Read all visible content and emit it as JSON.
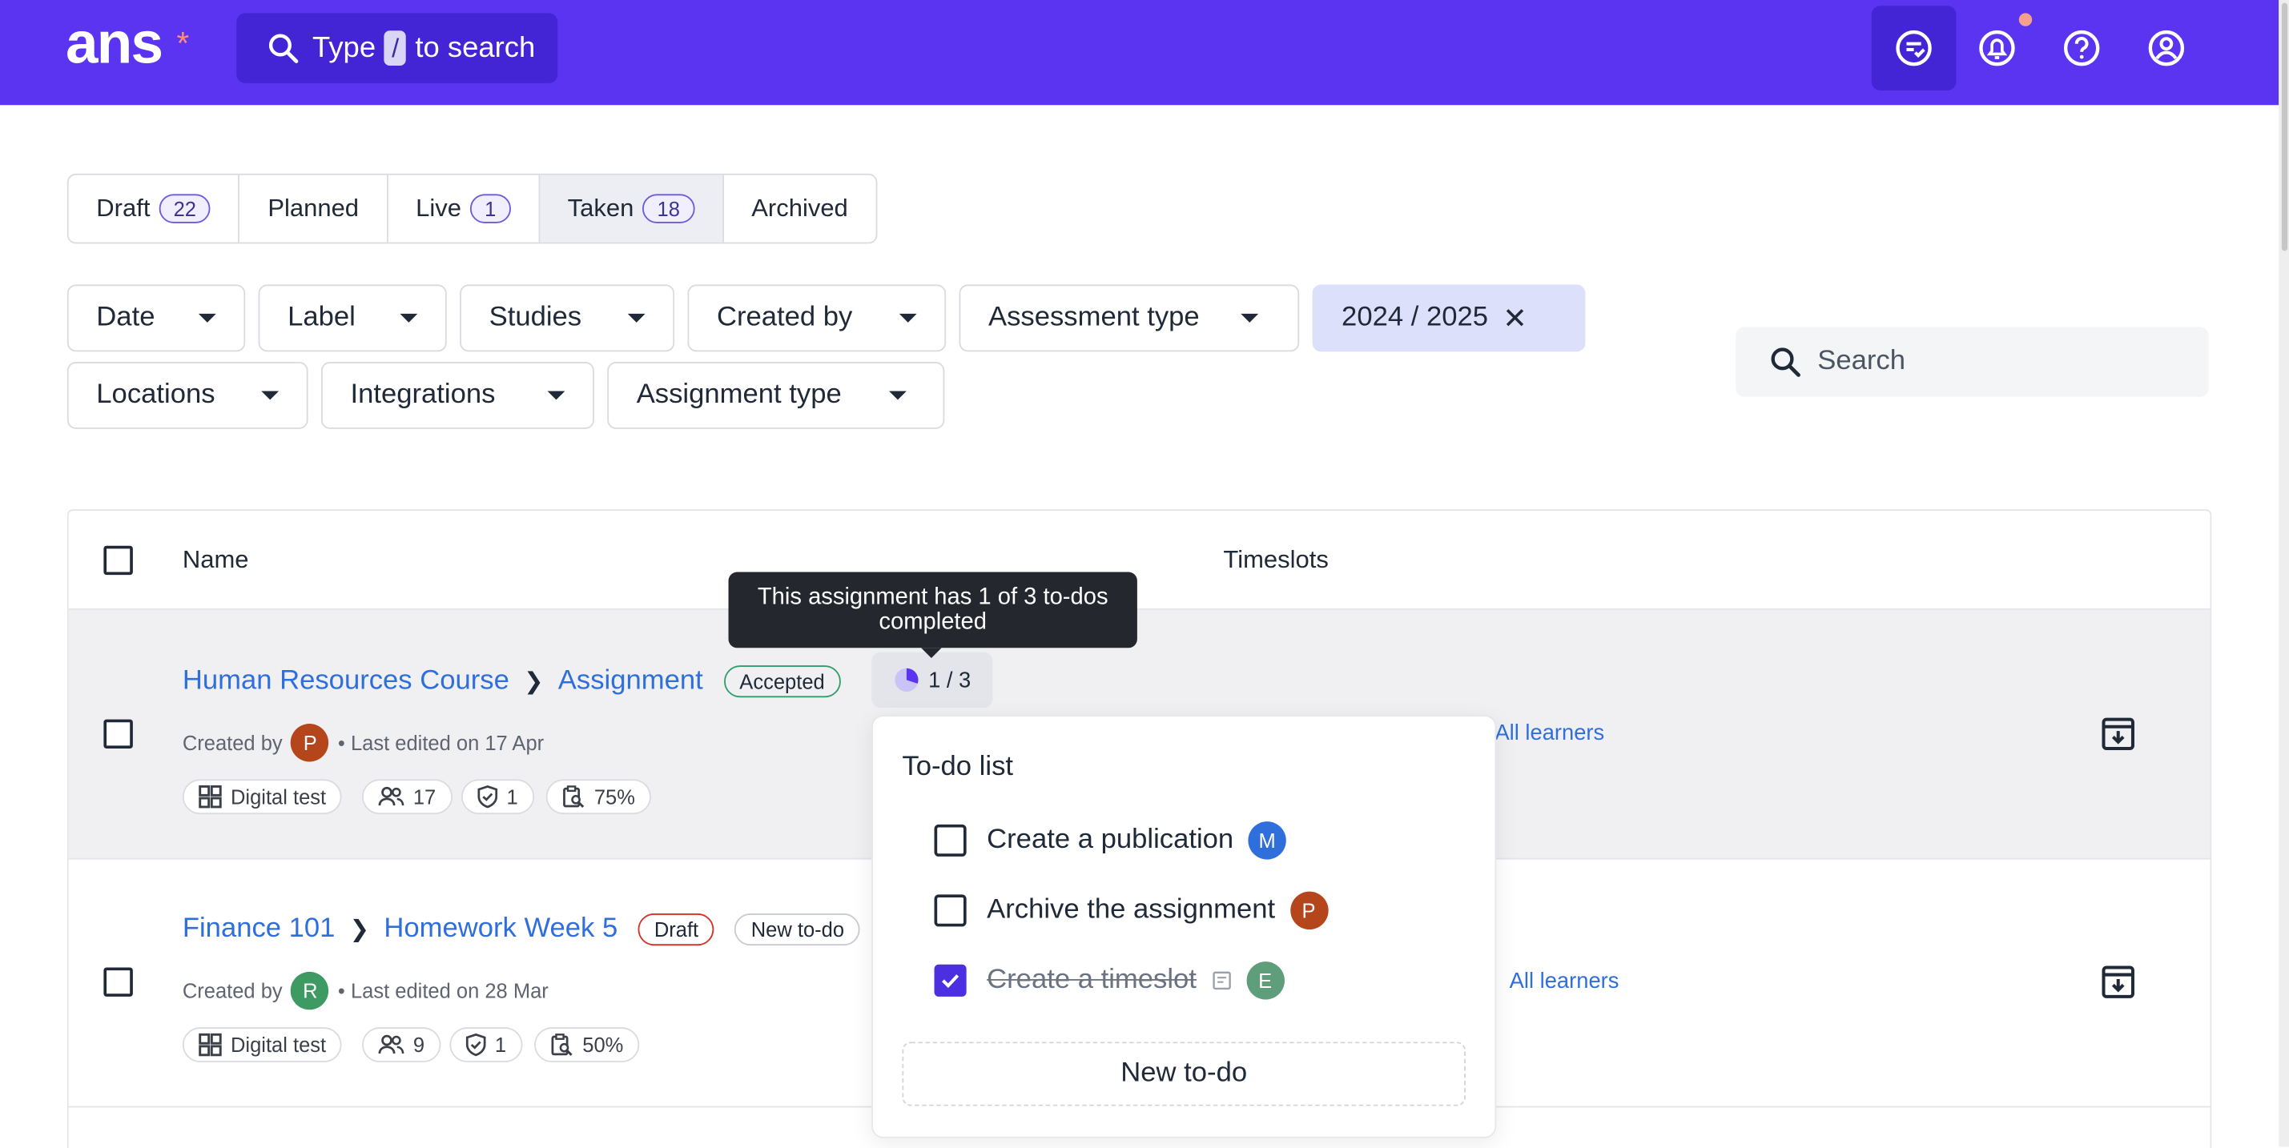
{
  "header": {
    "logo": "ans",
    "logo_mark": "*",
    "search_prefix": "Type",
    "search_key": "/",
    "search_suffix": "to search"
  },
  "tabs": [
    {
      "label": "Draft",
      "count": "22"
    },
    {
      "label": "Planned",
      "count": ""
    },
    {
      "label": "Live",
      "count": "1"
    },
    {
      "label": "Taken",
      "count": "18"
    },
    {
      "label": "Archived",
      "count": ""
    }
  ],
  "filters": {
    "date": "Date",
    "label": "Label",
    "studies": "Studies",
    "created_by": "Created by",
    "assessment_type": "Assessment type",
    "year": "2024 / 2025",
    "locations": "Locations",
    "integrations": "Integrations",
    "assignment_type": "Assignment type"
  },
  "search": {
    "placeholder": "Search"
  },
  "table": {
    "col_name": "Name",
    "col_timeslots": "Timeslots",
    "rows": [
      {
        "course": "Human Resources Course",
        "assignment": "Assignment",
        "status": "Accepted",
        "created_by_label": "Created by",
        "author_initial": "P",
        "edited": "• Last edited on 17 Apr",
        "type": "Digital test",
        "learners_count": "17",
        "checks": "1",
        "score": "75%",
        "timeslot": "All learners",
        "todo_progress": "1 / 3"
      },
      {
        "course": "Finance 101",
        "assignment": "Homework Week 5",
        "status": "Draft",
        "extra_badge": "New to-do",
        "created_by_label": "Created by",
        "author_initial": "R",
        "edited": "• Last edited on 28 Mar",
        "type": "Digital test",
        "learners_count": "9",
        "checks": "1",
        "score": "50%",
        "timeslot": "All learners"
      }
    ]
  },
  "tooltip": "This assignment has 1 of 3 to-dos completed",
  "todo_popover": {
    "title": "To-do list",
    "items": [
      {
        "label": "Create a publication",
        "assignee": "M",
        "done": false
      },
      {
        "label": "Archive the assignment",
        "assignee": "P",
        "done": false
      },
      {
        "label": "Create a timeslot",
        "assignee": "E",
        "done": true
      }
    ],
    "new_label": "New to-do"
  },
  "colors": {
    "brand": "#5b34f2",
    "link": "#2f6fdb",
    "avatar_p": "#b5461c",
    "avatar_r": "#3d9a62",
    "avatar_m": "#2f6fdb",
    "avatar_e": "#5f9e7a"
  }
}
